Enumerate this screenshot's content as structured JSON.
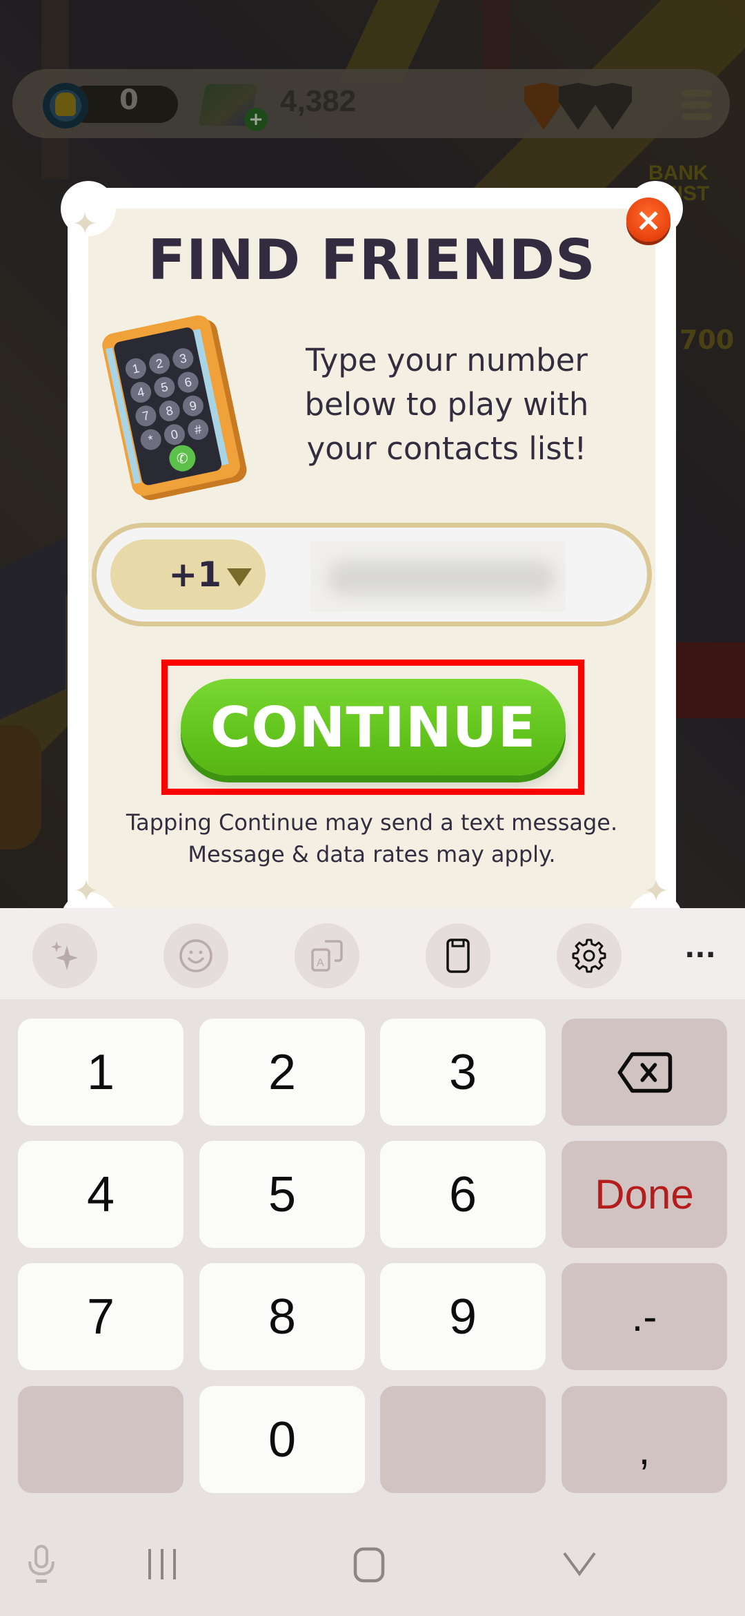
{
  "game_hud": {
    "level_value": "0",
    "cash_value": "4,382",
    "shields_total": 3,
    "shields_active": 1,
    "event_banner": "BANK HEIST",
    "event_amount": "700"
  },
  "modal": {
    "title": "FIND FRIENDS",
    "close_label": "×",
    "intro_text": "Type your number below to play with your contacts list!",
    "phone_illustration_keys": [
      "1",
      "2",
      "3",
      "4",
      "5",
      "6",
      "7",
      "8",
      "9",
      "*",
      "0",
      "#"
    ],
    "country_code": "+1",
    "phone_number_value": "",
    "phone_number_redacted": true,
    "continue_label": "CONTINUE",
    "disclaimer_line1": "Tapping Continue may send a text message.",
    "disclaimer_line2": "Message & data rates may apply.",
    "colors": {
      "title": "#332c40",
      "continue_green": "#61c31c",
      "close_orange": "#e8430f",
      "highlight_red": "#ff0000",
      "paper": "#f3f0e3"
    }
  },
  "keyboard": {
    "toolbar": [
      {
        "name": "ai-sparkle-icon"
      },
      {
        "name": "emoji-icon"
      },
      {
        "name": "translate-icon"
      },
      {
        "name": "clipboard-icon"
      },
      {
        "name": "settings-gear-icon"
      },
      {
        "name": "more-options-icon",
        "label": "···"
      }
    ],
    "keys": {
      "k1": "1",
      "k2": "2",
      "k3": "3",
      "k4": "4",
      "k5": "5",
      "k6": "6",
      "k7": "7",
      "k8": "8",
      "k9": "9",
      "k0": "0",
      "done": "Done",
      "dot_dash": ".-",
      "comma": ","
    },
    "done_color": "#b51d1d"
  },
  "nav_bar": {
    "items": [
      "microphone-icon",
      "recent-apps-icon",
      "home-icon",
      "hide-keyboard-icon"
    ]
  }
}
